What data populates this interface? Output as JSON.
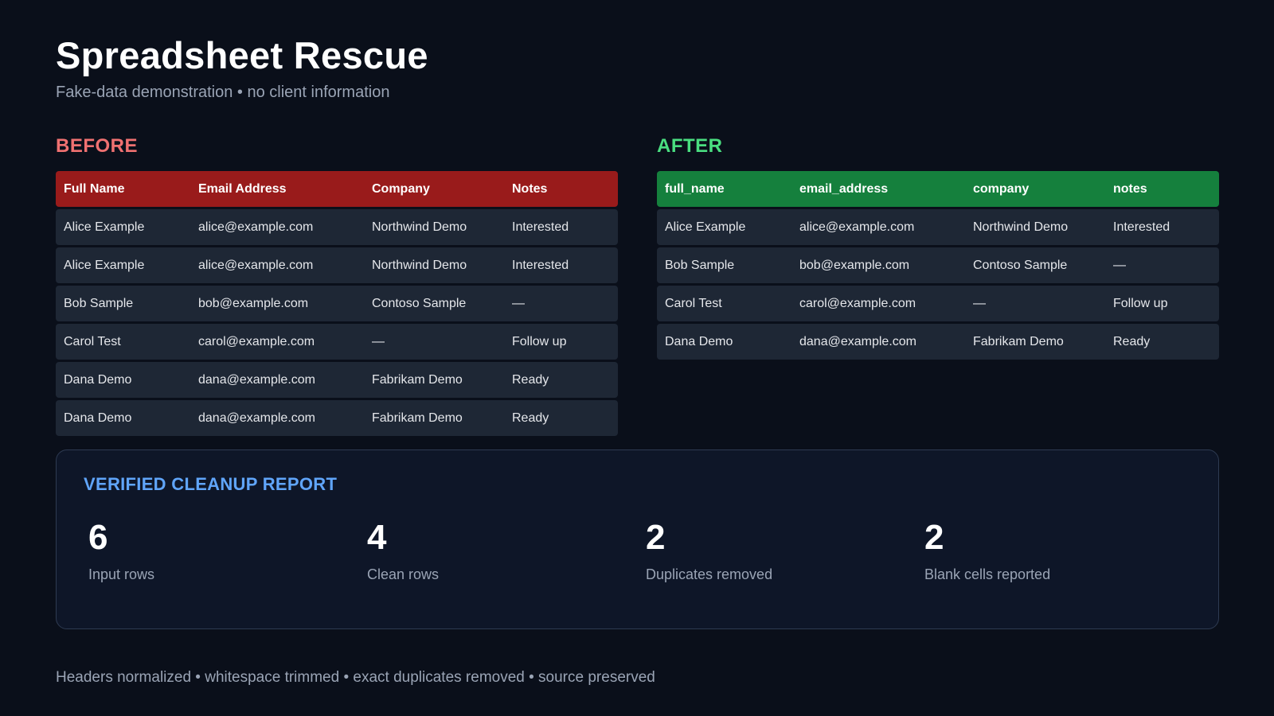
{
  "header": {
    "title": "Spreadsheet Rescue",
    "subtitle": "Fake-data demonstration • no client information"
  },
  "before": {
    "label": "BEFORE",
    "columns": [
      "Full Name",
      "Email Address",
      "Company",
      "Notes"
    ],
    "rows": [
      [
        "Alice Example",
        "alice@example.com",
        "Northwind Demo",
        "Interested"
      ],
      [
        "Alice Example",
        "alice@example.com",
        "Northwind Demo",
        "Interested"
      ],
      [
        "Bob Sample",
        "bob@example.com",
        "Contoso Sample",
        "—"
      ],
      [
        "Carol Test",
        "carol@example.com",
        "—",
        "Follow up"
      ],
      [
        "Dana Demo",
        "dana@example.com",
        "Fabrikam Demo",
        "Ready"
      ],
      [
        "Dana Demo",
        "dana@example.com",
        "Fabrikam Demo",
        "Ready"
      ]
    ]
  },
  "after": {
    "label": "AFTER",
    "columns": [
      "full_name",
      "email_address",
      "company",
      "notes"
    ],
    "rows": [
      [
        "Alice Example",
        "alice@example.com",
        "Northwind Demo",
        "Interested"
      ],
      [
        "Bob Sample",
        "bob@example.com",
        "Contoso Sample",
        "—"
      ],
      [
        "Carol Test",
        "carol@example.com",
        "—",
        "Follow up"
      ],
      [
        "Dana Demo",
        "dana@example.com",
        "Fabrikam Demo",
        "Ready"
      ]
    ]
  },
  "report": {
    "title": "VERIFIED CLEANUP REPORT",
    "stats": [
      {
        "value": "6",
        "label": "Input rows"
      },
      {
        "value": "4",
        "label": "Clean rows"
      },
      {
        "value": "2",
        "label": "Duplicates removed"
      },
      {
        "value": "2",
        "label": "Blank cells reported"
      }
    ]
  },
  "footer": {
    "text": "Headers normalized • whitespace trimmed • exact duplicates removed • source preserved"
  },
  "colors": {
    "background": "#0a0f1a",
    "before_accent": "#f07171",
    "before_header": "#991b1b",
    "after_accent": "#4ade80",
    "after_header": "#15803d",
    "report_accent": "#60a5fa"
  }
}
